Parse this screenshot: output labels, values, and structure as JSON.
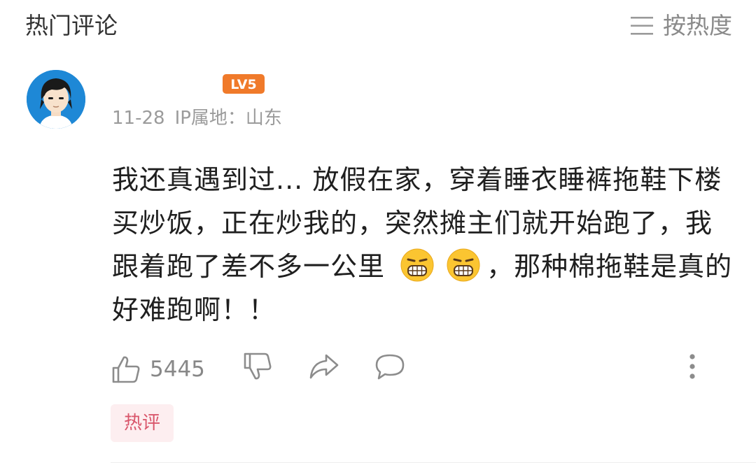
{
  "header": {
    "title": "热门评论",
    "sort_label": "按热度",
    "sort_icon": "menu-lines-icon"
  },
  "comment": {
    "avatar_icon": "cartoon-avatar",
    "level_badge": "LV5",
    "level_color": "#f07a2a",
    "date": "11-28",
    "ip_location": "IP属地：山东",
    "text_part1": "我还真遇到过... 放假在家，穿着睡衣睡裤拖鞋下楼买炒饭，正在炒我的，突然摊主们就开始跑了，我跟着跑了差不多一公里",
    "text_part2": "，那种棉拖鞋是真的好难跑啊！！",
    "emoji_icons": [
      "grimace-emoji",
      "grimace-emoji"
    ],
    "likes": "5445",
    "tag": "热评",
    "tag_color": "#d9566b"
  },
  "actions": {
    "like_icon": "thumbs-up-icon",
    "dislike_icon": "thumbs-down-icon",
    "share_icon": "share-arrow-icon",
    "reply_icon": "comment-bubble-icon",
    "more_icon": "more-vertical-icon"
  }
}
